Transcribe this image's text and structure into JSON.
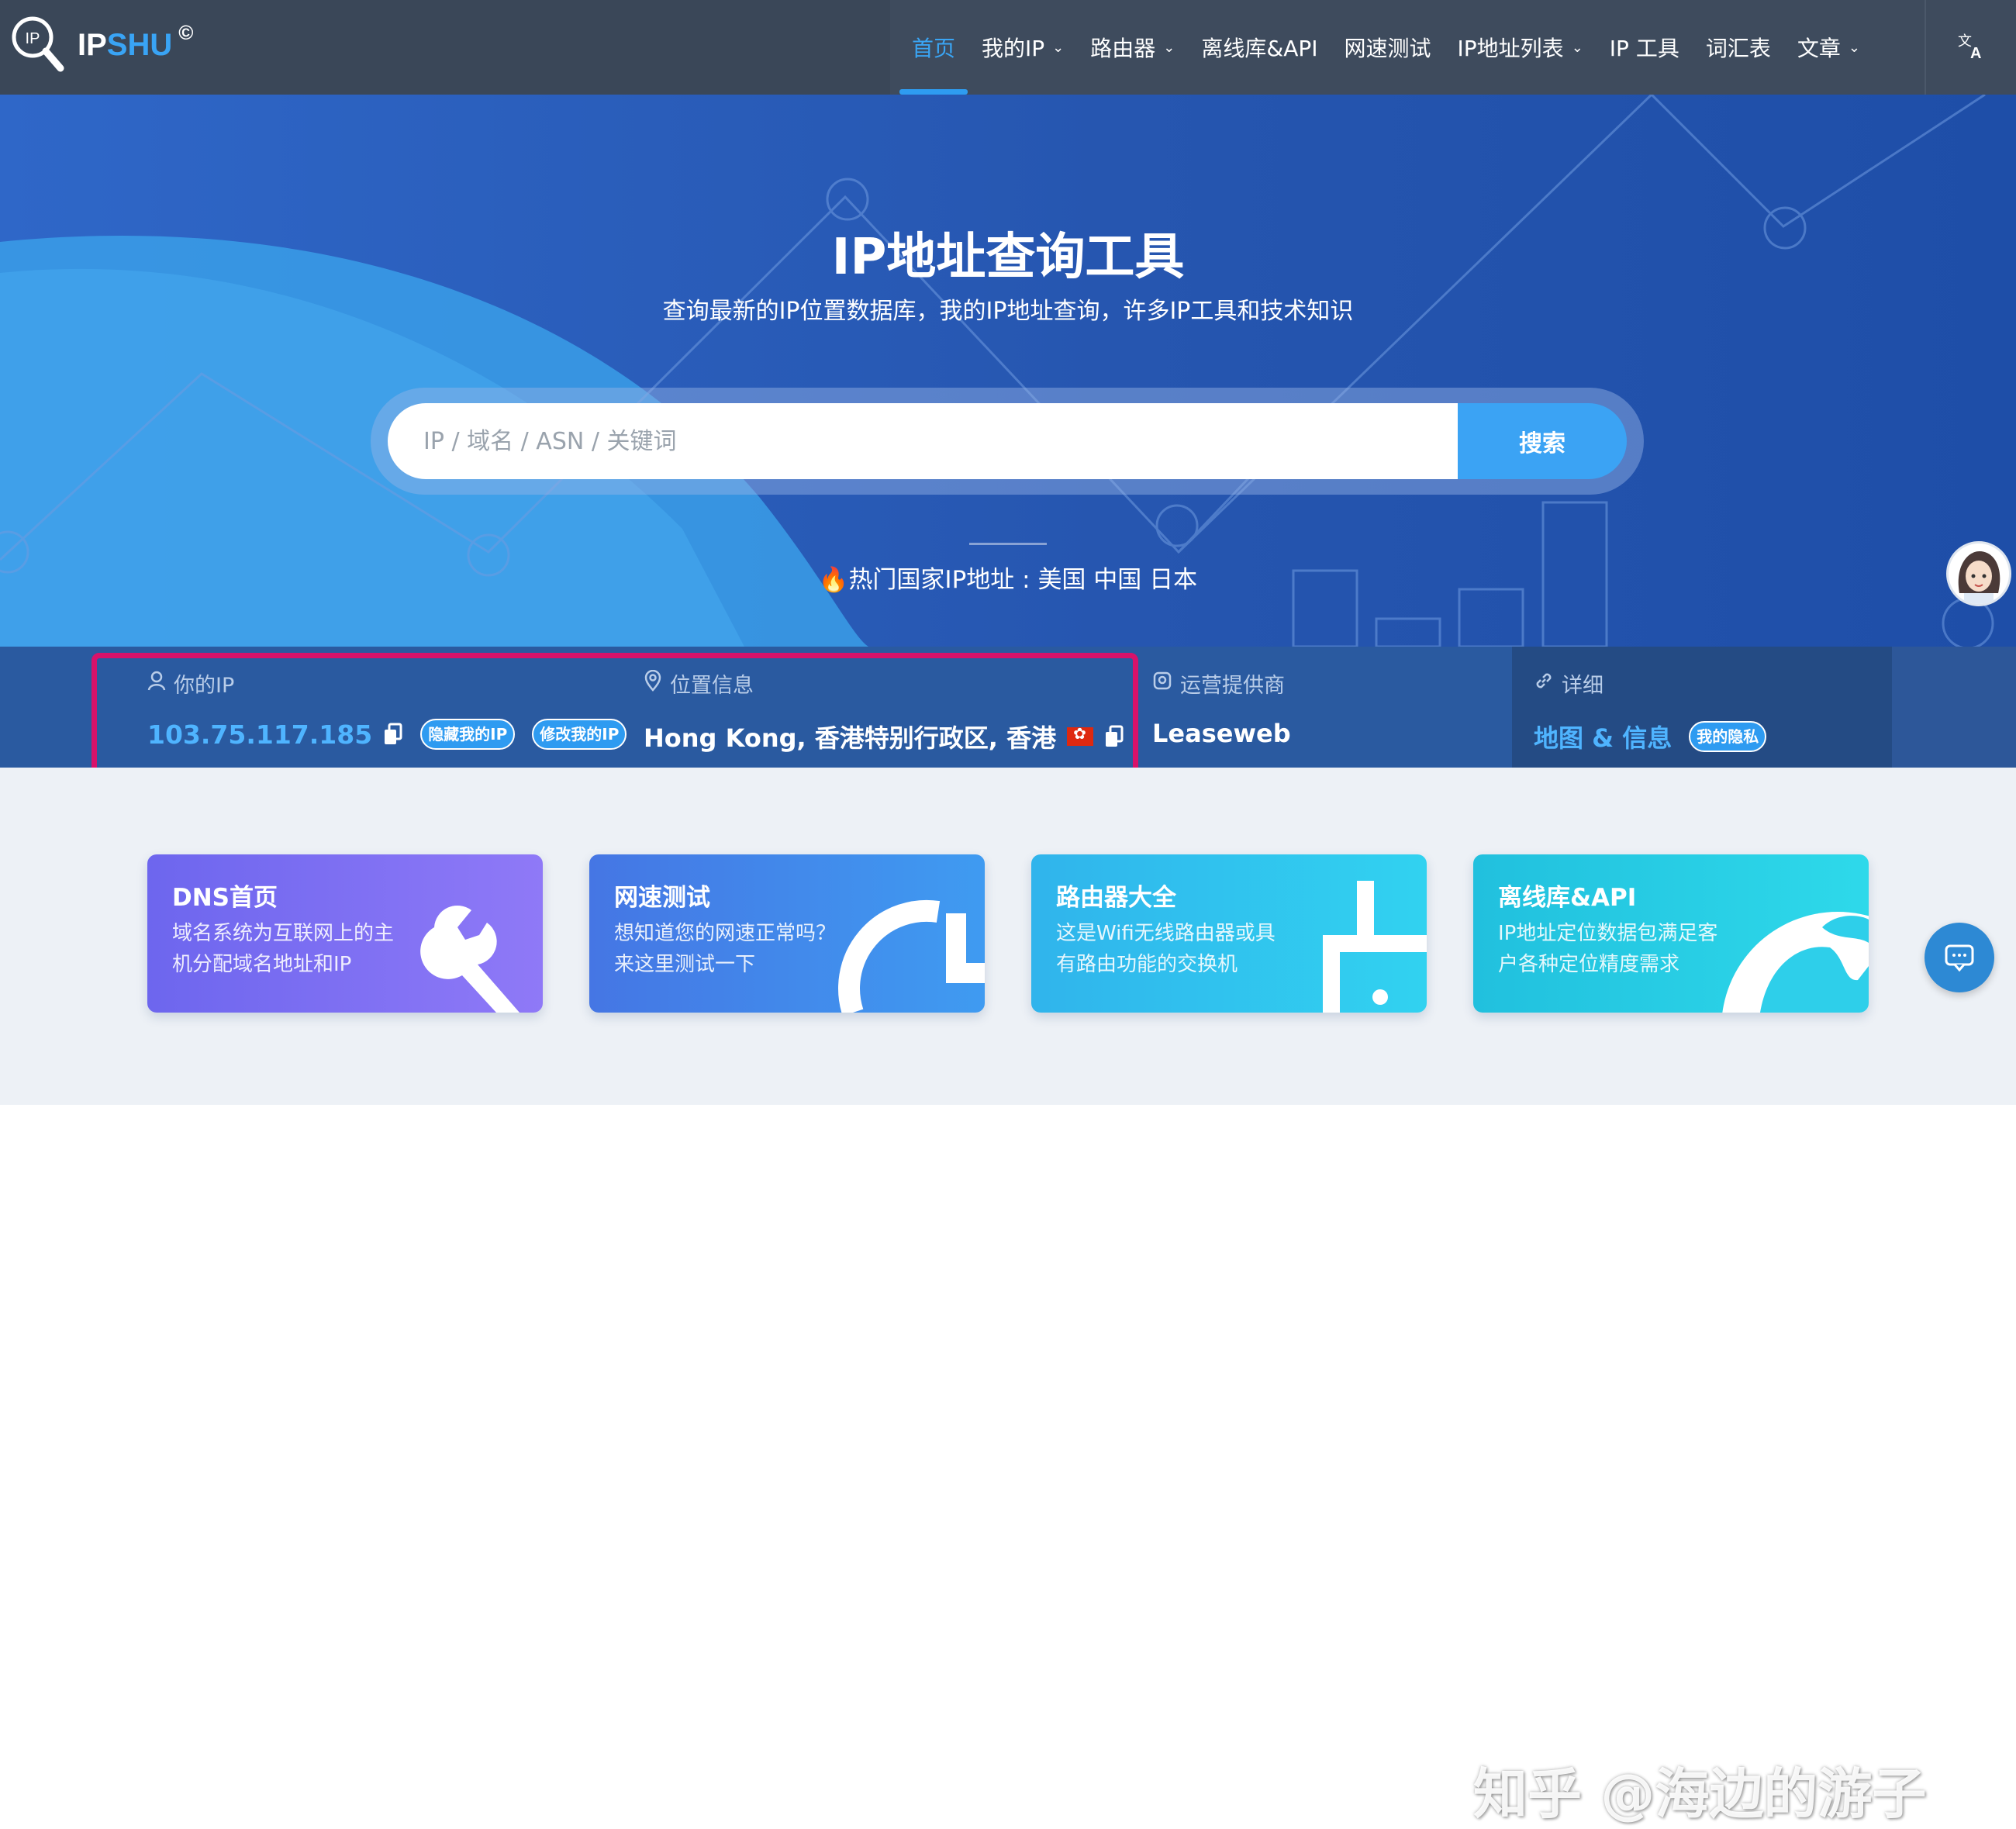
{
  "brand": {
    "ip": "IP",
    "shu": "SHU",
    "mark": "©"
  },
  "nav": {
    "items": [
      {
        "label": "首页",
        "active": true,
        "dropdown": false
      },
      {
        "label": "我的IP",
        "active": false,
        "dropdown": true
      },
      {
        "label": "路由器",
        "active": false,
        "dropdown": true
      },
      {
        "label": "离线库&API",
        "active": false,
        "dropdown": false
      },
      {
        "label": "网速测试",
        "active": false,
        "dropdown": false
      },
      {
        "label": "IP地址列表",
        "active": false,
        "dropdown": true
      },
      {
        "label": "IP 工具",
        "active": false,
        "dropdown": false
      },
      {
        "label": "词汇表",
        "active": false,
        "dropdown": false
      },
      {
        "label": "文章",
        "active": false,
        "dropdown": true
      }
    ],
    "language_icon": "translate-icon"
  },
  "hero": {
    "title": "IP地址查询工具",
    "subtitle": "查询最新的IP位置数据库，我的IP地址查询，许多IP工具和技术知识",
    "search_placeholder": "IP / 域名 / ASN / 关键词",
    "search_button": "搜索",
    "hot_prefix": "热门国家IP地址 : ",
    "hot_countries": [
      "美国",
      "中国",
      "日本"
    ]
  },
  "info": {
    "ip_label": "你的IP",
    "ip_value": "103.75.117.185",
    "hide_ip_button": "隐藏我的IP",
    "change_ip_button": "修改我的IP",
    "location_label": "位置信息",
    "location_value": "Hong Kong, 香港特别行政区, 香港",
    "isp_label": "运营提供商",
    "isp_value": "Leaseweb",
    "detail_label": "详细",
    "detail_link": "地图 & 信息",
    "privacy_button": "我的隐私"
  },
  "cards": [
    {
      "title": "DNS首页",
      "desc": "域名系统为互联网上的主机分配域名地址和IP",
      "icon": "wrench-icon"
    },
    {
      "title": "网速测试",
      "desc": "想知道您的网速正常吗？来这里测试一下",
      "icon": "speed-gauge-icon"
    },
    {
      "title": "路由器大全",
      "desc": "这是Wifi无线路由器或具有路由功能的交换机",
      "icon": "router-icon"
    },
    {
      "title": "离线库&API",
      "desc": "IP地址定位数据包满足客户各种定位精度需求",
      "icon": "globe-icon"
    }
  ],
  "watermark": "知乎 @海边的游子",
  "colors": {
    "header_bg": "#3a4758",
    "accent": "#3ba3f4",
    "hero_bg": "#2656b0",
    "highlight": "#d8126a"
  }
}
